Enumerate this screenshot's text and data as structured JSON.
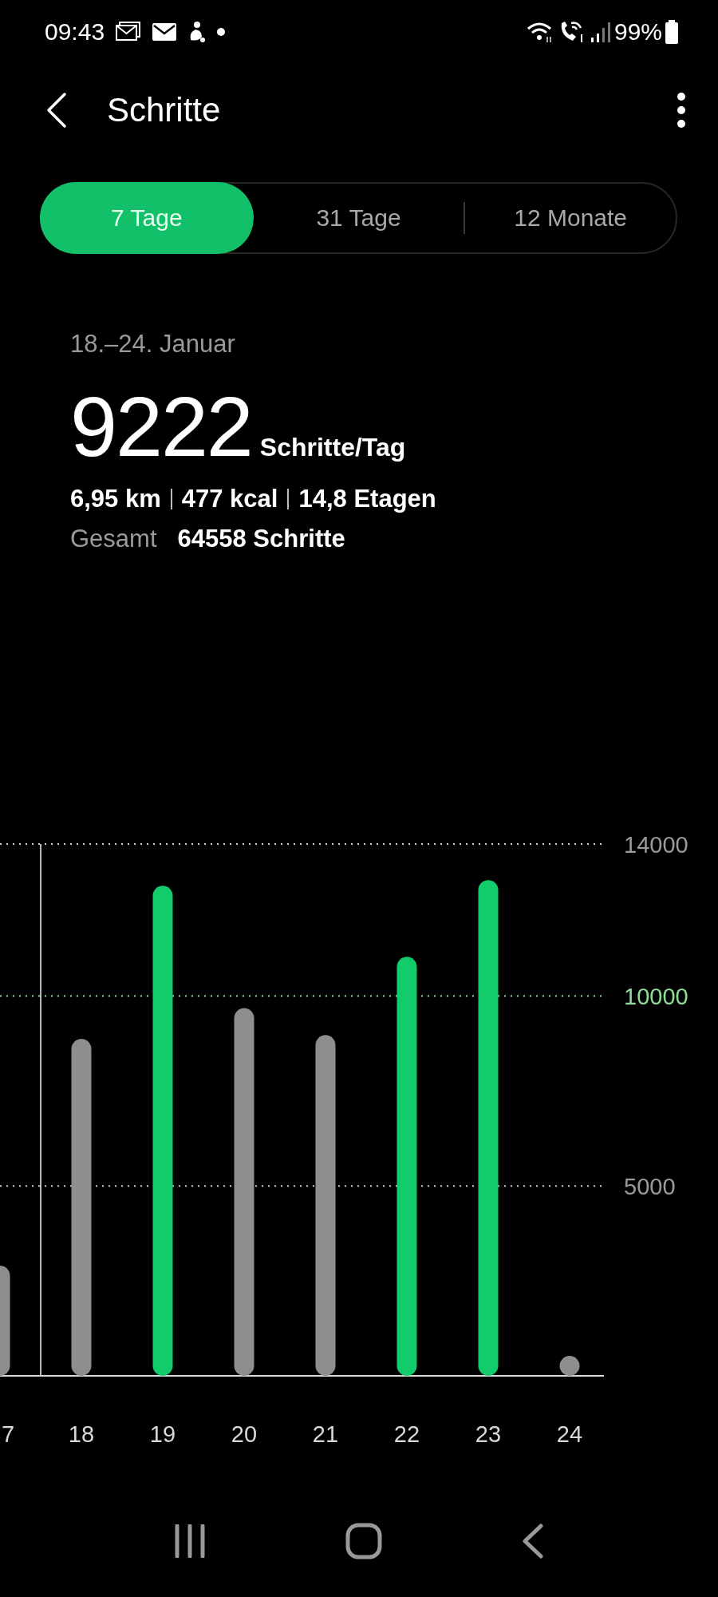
{
  "status_bar": {
    "time": "09:43",
    "battery": "99%"
  },
  "header": {
    "title": "Schritte"
  },
  "tabs": [
    {
      "label": "7 Tage",
      "selected": true
    },
    {
      "label": "31 Tage",
      "selected": false
    },
    {
      "label": "12 Monate",
      "selected": false
    }
  ],
  "summary": {
    "date_range": "18.–24. Januar",
    "average": "9222",
    "average_unit": "Schritte/Tag",
    "stats": [
      "6,95 km",
      "477 kcal",
      "14,8 Etagen"
    ],
    "total_label": "Gesamt",
    "total_value": "64558 Schritte"
  },
  "chart_data": {
    "type": "bar",
    "categories": [
      "7",
      "18",
      "19",
      "20",
      "21",
      "22",
      "23",
      "24"
    ],
    "series": [
      {
        "color": "#8e8e8e",
        "values": [
          2900,
          8870,
          null,
          9680,
          8970,
          null,
          null,
          500
        ]
      },
      {
        "color": "#12cc6c",
        "values": [
          null,
          null,
          12900,
          null,
          null,
          11030,
          13050,
          null
        ]
      }
    ],
    "ylim": [
      0,
      14000
    ],
    "yticks": [
      5000,
      10000,
      14000
    ],
    "ref_lines": [
      {
        "axis": "y",
        "value": 5000,
        "color": "#cfcfcf"
      },
      {
        "axis": "y",
        "value": 10000,
        "color": "#8fdc9c"
      },
      {
        "axis": "y",
        "value": 14000,
        "color": "#cfcfcf"
      }
    ]
  }
}
